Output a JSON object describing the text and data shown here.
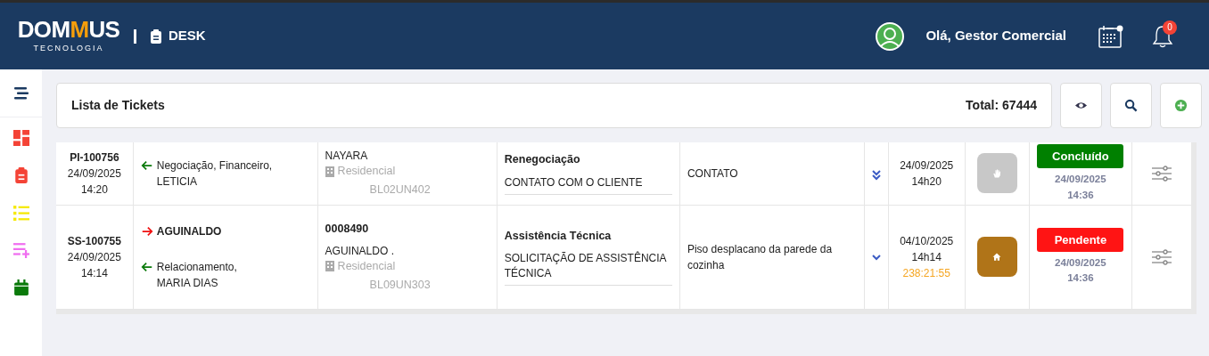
{
  "header": {
    "logo": "DOMMUS",
    "logo_sub": "TECNOLOGIA",
    "module": "DESK",
    "greeting": "Olá, Gestor Comercial",
    "notifications": "0"
  },
  "sidebar": {
    "items": [
      {
        "kind": "dashboard",
        "color": "#f44336"
      },
      {
        "kind": "clipboard",
        "color": "#f44336"
      },
      {
        "kind": "list",
        "color": "#f5e900"
      },
      {
        "kind": "list-add",
        "color": "#f06ef0"
      },
      {
        "kind": "calendar",
        "color": "#0b7a0b"
      }
    ]
  },
  "toolbar": {
    "title": "Lista de Tickets",
    "total": "Total: 67444",
    "buttons": [
      {
        "kind": "view"
      },
      {
        "kind": "search"
      },
      {
        "kind": "add"
      }
    ]
  },
  "table": {
    "rows": [
      {
        "id": "PI-100756",
        "date": "24/09/2025",
        "time": "14:20",
        "parties": [
          {
            "kind": "in",
            "department": "Negociação, Financeiro,",
            "person": "LETICIA",
            "bold": false
          }
        ],
        "code": "",
        "client": "NAYARA",
        "property_type": "Residencial",
        "unit": "BL02UN402",
        "category": "Renegociação",
        "subject": "CONTATO COM O CLIENTE",
        "description": "CONTATO",
        "priority": {
          "kind": "double"
        },
        "due_date": "24/09/2025",
        "due_time": "14h20",
        "action": {
          "kind": "hand"
        },
        "status": {
          "label": "Concluído",
          "color": "#008000"
        },
        "status_date": "24/09/2025",
        "status_time": "14:36"
      },
      {
        "id": "SS-100755",
        "date": "24/09/2025",
        "time": "14:14",
        "parties": [
          {
            "kind": "out",
            "person": "AGUINALDO",
            "bold": true
          },
          {
            "kind": "in",
            "department": "Relacionamento,",
            "person": "MARIA DIAS",
            "bold": false
          }
        ],
        "code": "0008490",
        "client": "AGUINALDO .",
        "property_type": "Residencial",
        "unit": "BL09UN303",
        "category": "Assistência Técnica",
        "subject": "SOLICITAÇÃO DE ASSISTÊNCIA TÉCNICA",
        "description": "Piso desplacano da parede da cozinha",
        "priority": {
          "kind": "single"
        },
        "due_date": "04/10/2025",
        "due_time": "14h14",
        "elapsed": "238:21:55",
        "action": {
          "kind": "home"
        },
        "status": {
          "label": "Pendente",
          "color": "#ff1414"
        },
        "status_date": "24/09/2025",
        "status_time": "14:36"
      }
    ]
  }
}
